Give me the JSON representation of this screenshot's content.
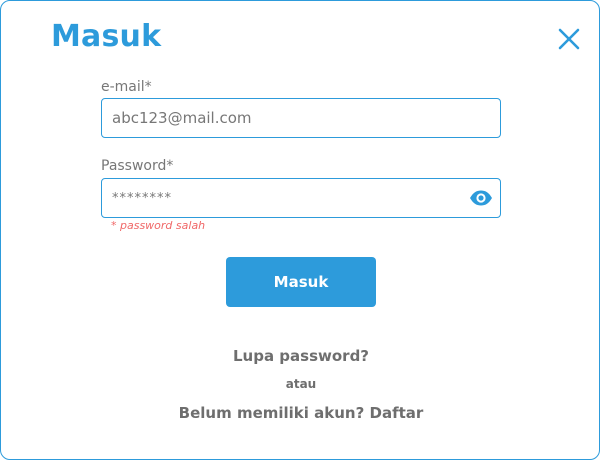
{
  "dialog": {
    "title": "Masuk",
    "close_icon": "close-icon"
  },
  "form": {
    "email": {
      "label": "e-mail*",
      "value": "abc123@mail.com"
    },
    "password": {
      "label": "Password*",
      "value": "********",
      "toggle_icon": "eye-icon",
      "error": "* password  salah"
    },
    "submit_label": "Masuk"
  },
  "links": {
    "forgot_password": "Lupa password?",
    "or": "atau",
    "register": "Belum memiliki akun? Daftar"
  },
  "colors": {
    "accent": "#2d9bdb",
    "error": "#f06868",
    "text_muted": "#777777"
  }
}
